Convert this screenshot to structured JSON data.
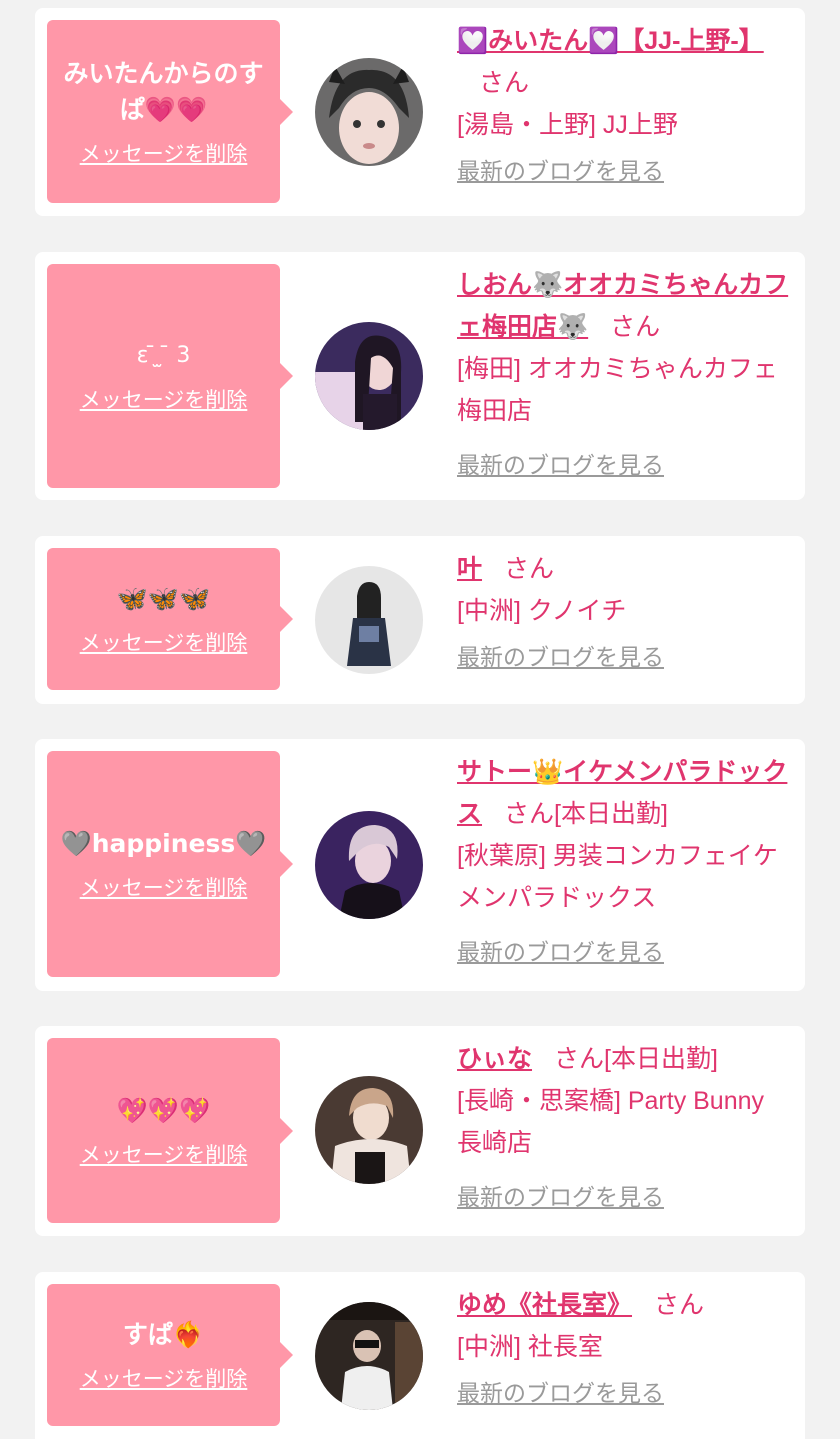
{
  "delete_label": "メッセージを削除",
  "blog_label": "最新のブログを見る",
  "colors": {
    "accent": "#e0356e",
    "bubble": "#ff97a8",
    "muted_link": "#9a9a9a",
    "background": "#f2f2f2"
  },
  "cards": [
    {
      "message": "みいたんからのすぱ💗💗",
      "name": "💟みいたん💟【JJ-上野-】",
      "honorific": "さん",
      "status": "",
      "shop": "[湯島・上野] JJ上野"
    },
    {
      "message": "ε ̄ ̫ ̄ 3",
      "name": "しおん🐺オオカミちゃんカフェ梅田店🐺",
      "honorific": "さん",
      "status": "",
      "shop": "[梅田] オオカミちゃんカフェ梅田店"
    },
    {
      "message": "🦋🦋🦋",
      "name": "叶",
      "honorific": "さん",
      "status": "",
      "shop": "[中洲] クノイチ"
    },
    {
      "message": "🩶happiness🩶",
      "name": "サトー👑イケメンパラドックス",
      "honorific": "さん",
      "status": "[本日出勤]",
      "shop": "[秋葉原] 男装コンカフェイケメンパラドックス"
    },
    {
      "message": "💖💖💖",
      "name": "ひぃな",
      "honorific": "さん",
      "status": "[本日出勤]",
      "shop": "[長崎・思案橋] Party Bunny 長崎店"
    },
    {
      "message": "すぱ❤️‍🔥",
      "name": "ゆめ《社長室》",
      "honorific": "さん",
      "status": "",
      "shop": "[中洲] 社長室"
    }
  ]
}
